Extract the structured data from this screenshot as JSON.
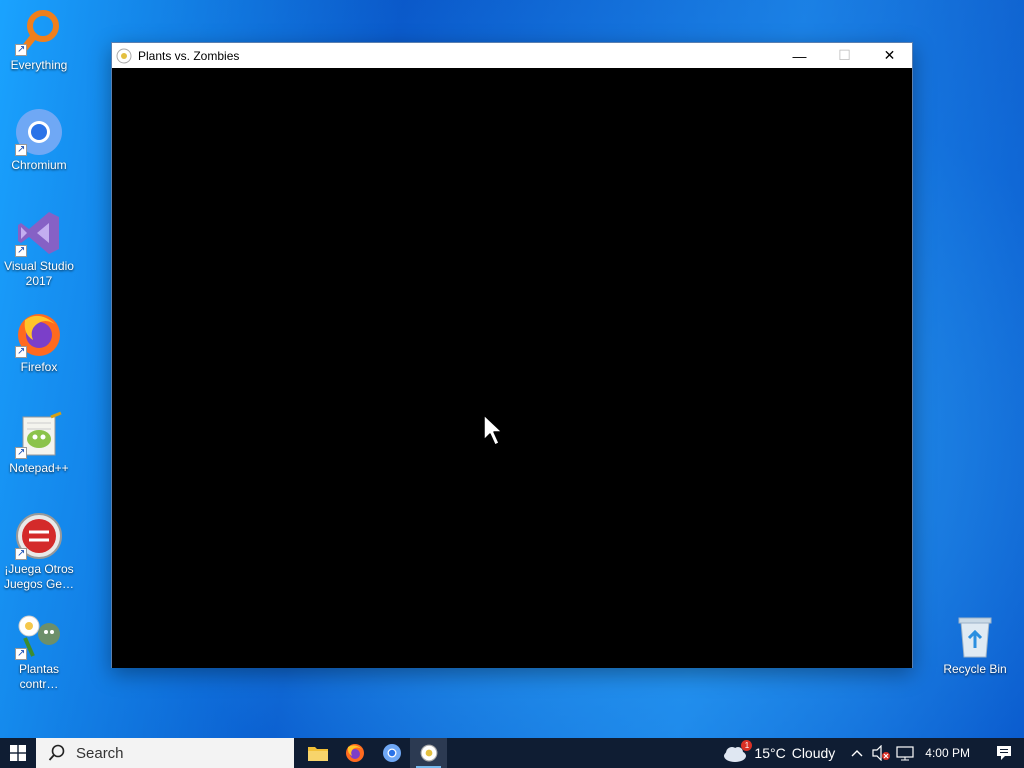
{
  "desktop": {
    "icons": [
      {
        "label": "Everything",
        "icon": "magnifier-icon"
      },
      {
        "label": "Chromium",
        "icon": "chromium-icon"
      },
      {
        "label": "Visual Studio 2017",
        "icon": "visual-studio-icon"
      },
      {
        "label": "Firefox",
        "icon": "firefox-icon"
      },
      {
        "label": "Notepad++",
        "icon": "notepad-plus-plus-icon"
      },
      {
        "label": "¡Juega Otros Juegos Ge…",
        "icon": "popcap-icon"
      },
      {
        "label": "Plantas contr…",
        "icon": "pvz-icon"
      },
      {
        "label": "Recycle Bin",
        "icon": "recycle-bin-icon"
      }
    ]
  },
  "window": {
    "title": "Plants vs. Zombies",
    "minimize_label": "—",
    "maximize_label": "☐",
    "close_label": "✕"
  },
  "taskbar": {
    "search_label": "Search",
    "weather": {
      "temp": "15°C",
      "condition": "Cloudy",
      "alert_count": "1"
    },
    "clock": "4:00 PM",
    "colors": {
      "bar": "#0f1d33",
      "accent": "#76b9ed"
    }
  }
}
